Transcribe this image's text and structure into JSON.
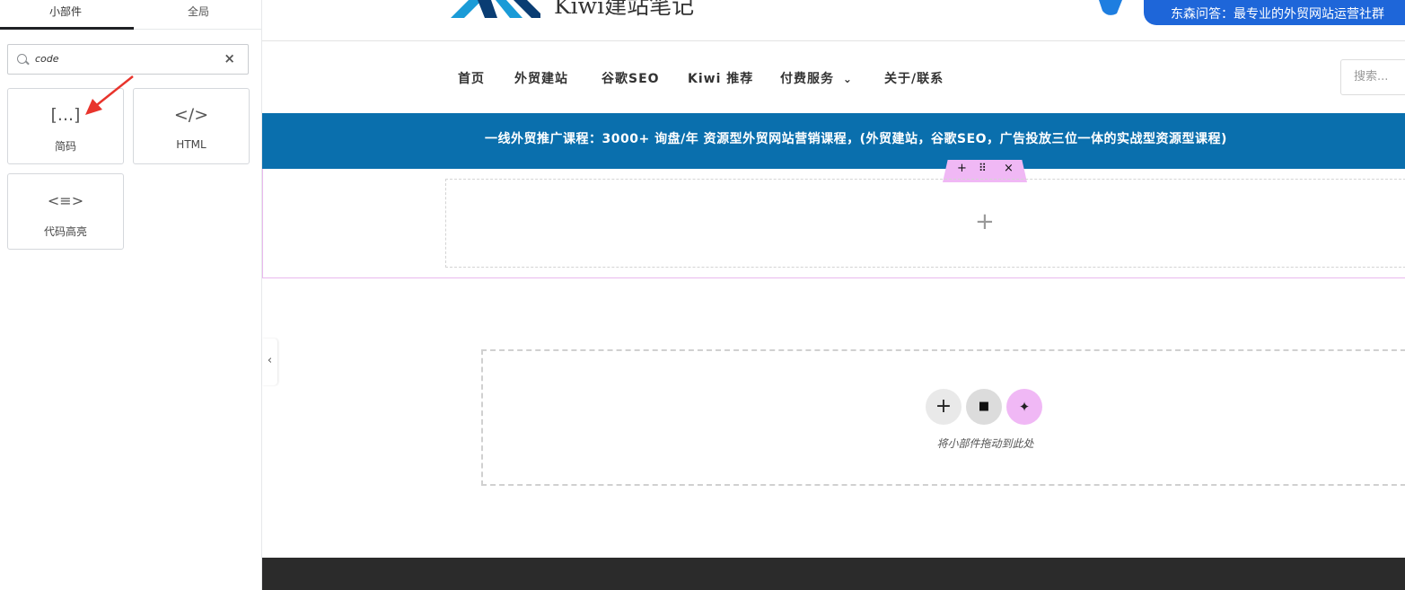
{
  "panel": {
    "tabs": [
      "小部件",
      "全局"
    ],
    "search": {
      "value": "code",
      "clear_label": "×"
    },
    "widgets": [
      {
        "icon_text": "[...]",
        "label": "简码",
        "icon": "shortcode-icon"
      },
      {
        "icon_text": "</>",
        "label": "HTML",
        "icon": "html-code-icon"
      },
      {
        "icon_text": "<≡>",
        "label": "代码高亮",
        "icon": "code-highlight-icon"
      }
    ],
    "collapse_label": "‹"
  },
  "site": {
    "logo_text": "Kiwi建站笔记",
    "ad_text": "东森问答：最专业的外贸网站运营社群",
    "nav": [
      "首页",
      "外贸建站",
      "谷歌SEO",
      "Kiwi 推荐",
      "付费服务",
      "关于/联系"
    ],
    "nav_dropdown_glyph": "⌄",
    "search_placeholder": "搜索...",
    "banner": "一线外贸推广课程：3000+ 询盘/年 资源型外贸网站营销课程，(外贸建站，谷歌SEO，广告投放三位一体的实战型资源型课程)",
    "section_handle": {
      "add": "+",
      "move": "⠿",
      "close": "×"
    },
    "column_add": "+",
    "dropzone": {
      "add": "+",
      "folder": "■",
      "ai": "✦",
      "text": "将小部件拖动到此处"
    }
  },
  "colors": {
    "banner": "#0a6fad",
    "accent_pink": "#f0b8f5",
    "ad_blue": "#1e66d9",
    "footer": "#2b2b2b"
  }
}
